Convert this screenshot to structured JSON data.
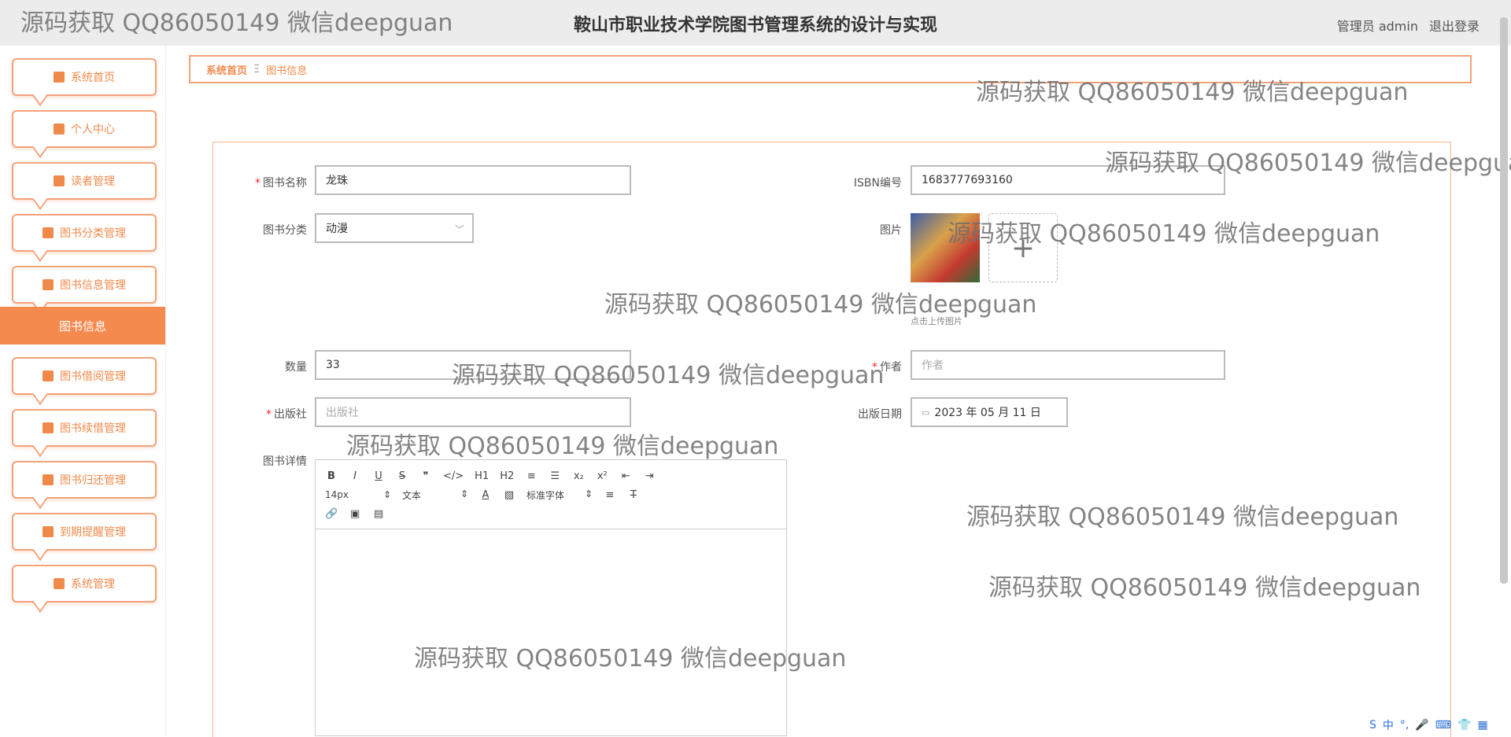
{
  "header": {
    "title": "鞍山市职业技术学院图书管理系统的设计与实现",
    "user_label": "管理员 admin",
    "logout_label": "退出登录"
  },
  "sidebar": {
    "items": [
      {
        "label": "系统首页",
        "icon": "home-icon"
      },
      {
        "label": "个人中心",
        "icon": "user-icon"
      },
      {
        "label": "读者管理",
        "icon": "briefcase-icon"
      },
      {
        "label": "图书分类管理",
        "icon": "chat-icon"
      },
      {
        "label": "图书信息管理",
        "icon": "monitor-icon"
      },
      {
        "label": "图书借阅管理",
        "icon": "bulb-icon"
      },
      {
        "label": "图书续借管理",
        "icon": "clipboard-icon"
      },
      {
        "label": "图书归还管理",
        "icon": "ticket-icon"
      },
      {
        "label": "到期提醒管理",
        "icon": "grid-icon"
      },
      {
        "label": "系统管理",
        "icon": "grid-icon"
      }
    ],
    "active_sub": "图书信息"
  },
  "breadcrumb": {
    "home": "系统首页",
    "separator": "Ξ",
    "current": "图书信息"
  },
  "form": {
    "book_name": {
      "label": "图书名称",
      "value": "龙珠"
    },
    "isbn": {
      "label": "ISBN编号",
      "value": "1683777693160"
    },
    "category": {
      "label": "图书分类",
      "value": "动漫"
    },
    "image": {
      "label": "图片",
      "hint": "点击上传图片"
    },
    "quantity": {
      "label": "数量",
      "value": "33"
    },
    "author": {
      "label": "作者",
      "placeholder": "作者"
    },
    "publisher": {
      "label": "出版社",
      "placeholder": "出版社"
    },
    "publish_date": {
      "label": "出版日期",
      "value": "2023 年 05 月 11 日"
    },
    "details": {
      "label": "图书详情"
    }
  },
  "editor": {
    "row1": [
      "B",
      "I",
      "U",
      "S",
      "❞",
      "</>",
      "H1",
      "H2",
      "≡",
      "☰",
      "x₂",
      "x²",
      "⇤",
      "⇥"
    ],
    "font_size": "14px",
    "text_style": "文本",
    "font_family": "标准字体",
    "row3": [
      "🔗",
      "▣",
      "▤"
    ]
  },
  "watermark": "源码获取 QQ86050149 微信deepguan",
  "colors": {
    "accent": "#f48a4e",
    "required": "#f5222d"
  }
}
